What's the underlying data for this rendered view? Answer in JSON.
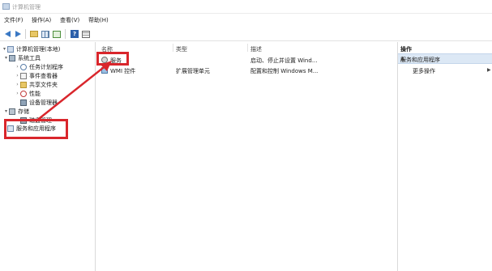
{
  "window": {
    "title": "计算机管理"
  },
  "menu": [
    "文件(F)",
    "操作(A)",
    "查看(V)",
    "帮助(H)"
  ],
  "toolbar": [
    "back-arrow-icon",
    "forward-arrow-icon",
    "folder-up-icon",
    "show-hide-tree-icon",
    "refresh-icon",
    "help-icon",
    "properties-icon"
  ],
  "tree": {
    "root": "计算机管理(本地)",
    "system_tools": "系统工具",
    "task_scheduler": "任务计划程序",
    "event_viewer": "事件查看器",
    "shared_folders": "共享文件夹",
    "performance": "性能",
    "device_manager": "设备管理器",
    "storage": "存储",
    "disk_management": "磁盘管理",
    "services_apps": "服务和应用程序"
  },
  "list": {
    "columns": {
      "name": "名称",
      "type": "类型",
      "desc": "描述"
    },
    "rows": [
      {
        "name": "服务",
        "type": "",
        "desc": "启动、停止并设置 Wind..."
      },
      {
        "name": "WMI 控件",
        "type": "扩展管理单元",
        "desc": "配置和控制 Windows M..."
      }
    ]
  },
  "actions": {
    "header": "操作",
    "section": "服务和应用程序",
    "more": "更多操作",
    "more_chevron": "▶",
    "collapse": "▲"
  },
  "colors": {
    "highlight": "#d9262c",
    "selection": "#dce8f5"
  }
}
